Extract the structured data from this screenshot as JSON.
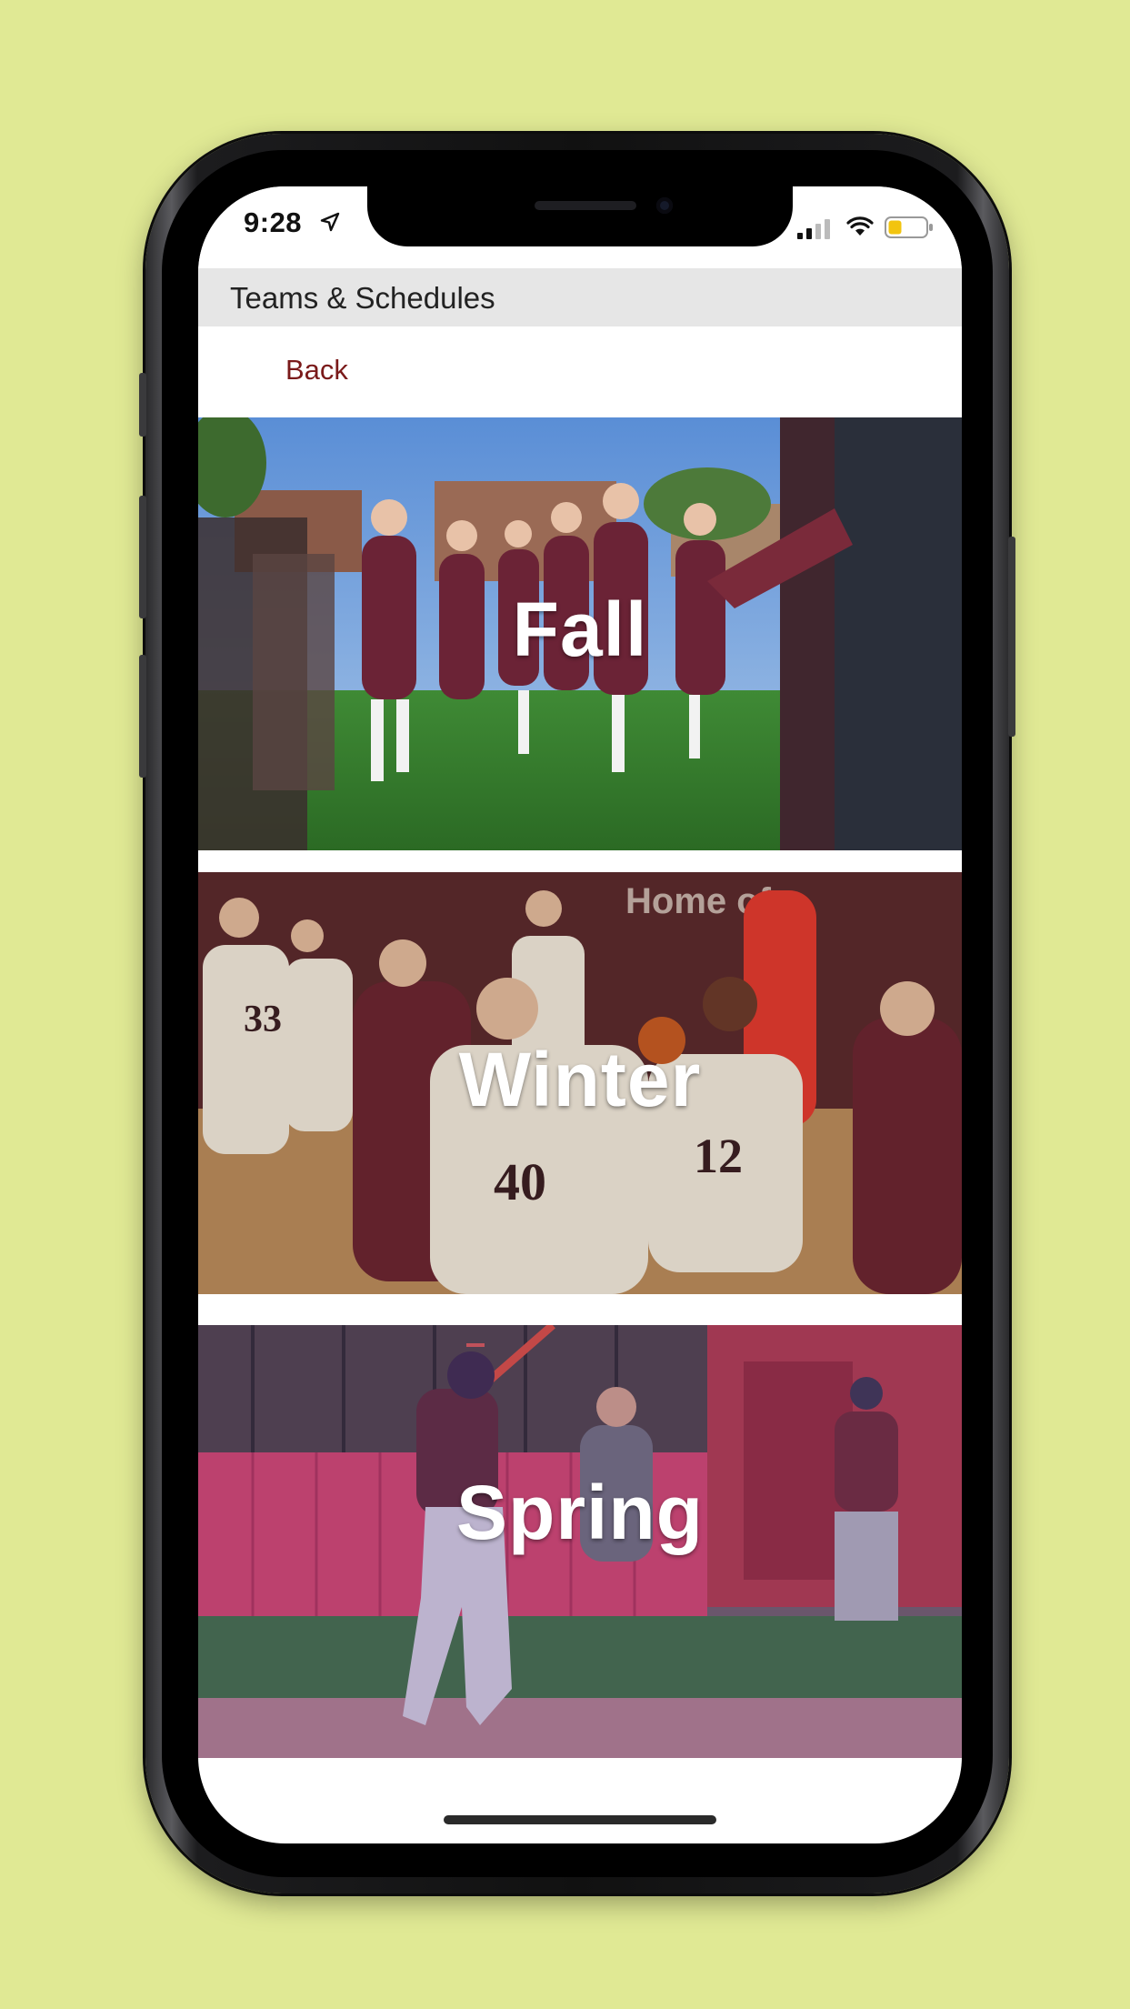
{
  "status_bar": {
    "time": "9:28",
    "location_icon": "location-arrow-icon",
    "signal_icon": "cellular-signal-icon",
    "wifi_icon": "wifi-icon",
    "battery_icon": "battery-icon",
    "battery_color": "#f2c40f"
  },
  "header": {
    "title": "Teams & Schedules"
  },
  "nav": {
    "back_label": "Back"
  },
  "seasons": [
    {
      "label": "Fall"
    },
    {
      "label": "Winter"
    },
    {
      "label": "Spring"
    }
  ],
  "colors": {
    "background": "#e0e994",
    "accent": "#7a1a1a",
    "title_bar": "#e6e6e6"
  }
}
